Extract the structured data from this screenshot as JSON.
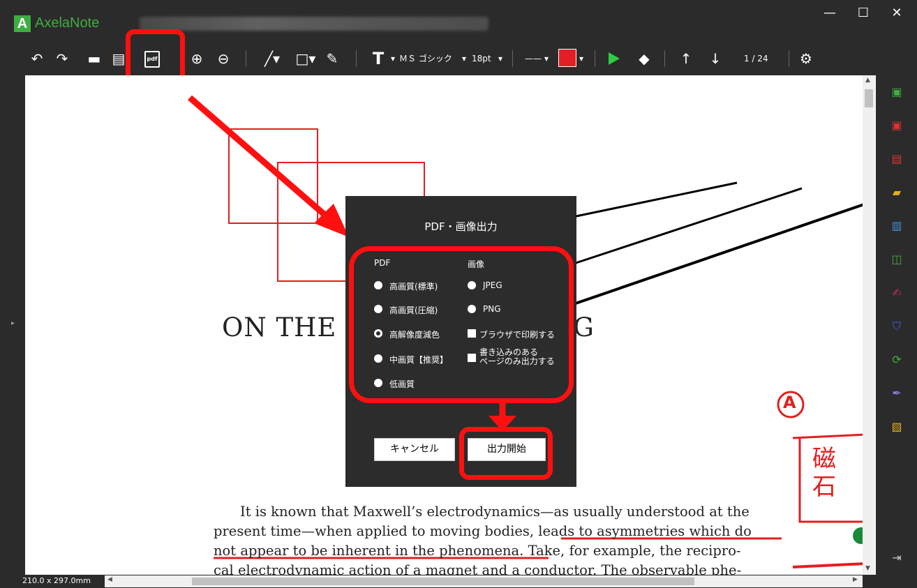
{
  "titlebar": {
    "app_name": "AxelaNote",
    "logo_letter": "A",
    "minimize": "—",
    "maximize": "☐",
    "close": "✕"
  },
  "toolbar": {
    "pdf_label": "pdf",
    "font_name": "ＭＳ ゴシック",
    "font_size": "18pt",
    "page_indicator": "1 / 24",
    "text_tool": "T",
    "line_sample": "——",
    "colors": {
      "selected_color": "#e31e24",
      "highlight": "#ff1010",
      "play": "#2ecc40"
    }
  },
  "document": {
    "heading": "ON THE E         CS OF MOVING",
    "paragraph_line1": "It is known that Maxwell’s electrodynamics—as usually understood at the",
    "paragraph_line2": "present time—when applied to moving bodies, leads to asymmetries which do",
    "paragraph_line3": "not appear to be inherent in the phenomena. Take, for example, the recipro-",
    "paragraph_line4": "cal electrodynamic action of a magnet and a conductor. The observable phe-",
    "annotation_circle": "A",
    "annotation_note": "磁石"
  },
  "dialog": {
    "title": "PDF・画像出力",
    "pdf_header": "PDF",
    "image_header": "画像",
    "pdf_options": [
      "高画質(標準)",
      "高画質(圧縮)",
      "高解像度減色",
      "中画質【推奨】",
      "低画質"
    ],
    "pdf_selected_index": 2,
    "image_options": [
      "JPEG",
      "PNG"
    ],
    "checkbox_print": "ブラウザで印刷する",
    "checkbox_written_line1": "書き込みのある",
    "checkbox_written_line2": "ページのみ出力する",
    "cancel_label": "キャンセル",
    "start_label": "出力開始"
  },
  "statusbar": {
    "page_size": "210.0 x 297.0mm"
  }
}
